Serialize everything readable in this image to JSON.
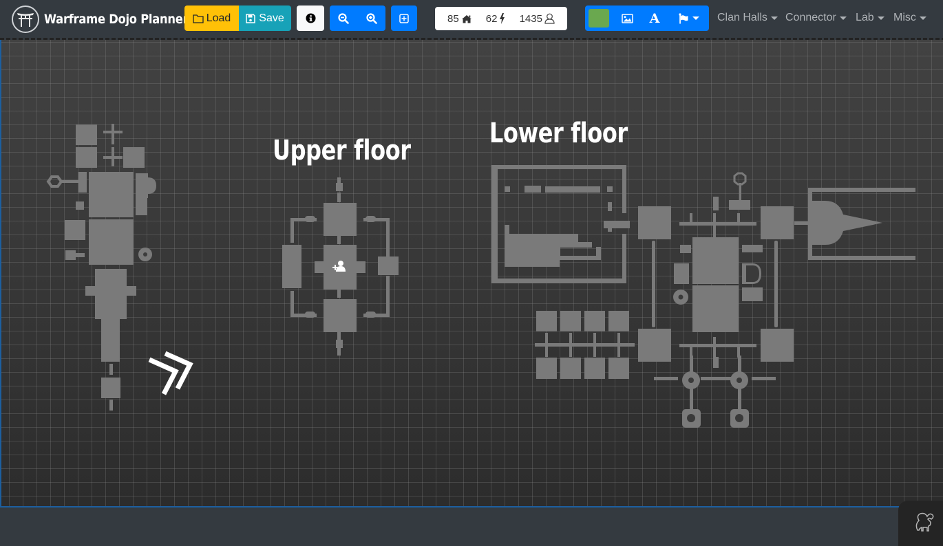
{
  "app": {
    "title": "Warframe Dojo Planner",
    "logo_icon": "torii-gate-icon"
  },
  "toolbar": {
    "load_label": "Load",
    "load_icon": "folder-icon",
    "save_label": "Save",
    "save_icon": "floppy-disk-icon",
    "info_icon": "info-circle-icon",
    "zoom_out_icon": "zoom-out-icon",
    "zoom_in_icon": "zoom-in-icon",
    "grid_icon": "plus-square-icon"
  },
  "stats": {
    "rooms": "85",
    "rooms_icon": "home-icon",
    "energy": "62",
    "energy_icon": "bolt-icon",
    "capacity": "1435",
    "capacity_icon": "user-icon"
  },
  "tools": {
    "color": "#6aa84f",
    "image_icon": "image-icon",
    "text_icon": "font-icon",
    "flag_icon": "flag-icon"
  },
  "menus": [
    {
      "label": "Clan Halls"
    },
    {
      "label": "Connector"
    },
    {
      "label": "Lab"
    },
    {
      "label": "Misc"
    }
  ],
  "canvas": {
    "labels": [
      {
        "text": "Upper floor"
      },
      {
        "text": "Lower floor"
      }
    ],
    "room_color": "#7a7a7a",
    "background_color": "#3a3a3a"
  }
}
